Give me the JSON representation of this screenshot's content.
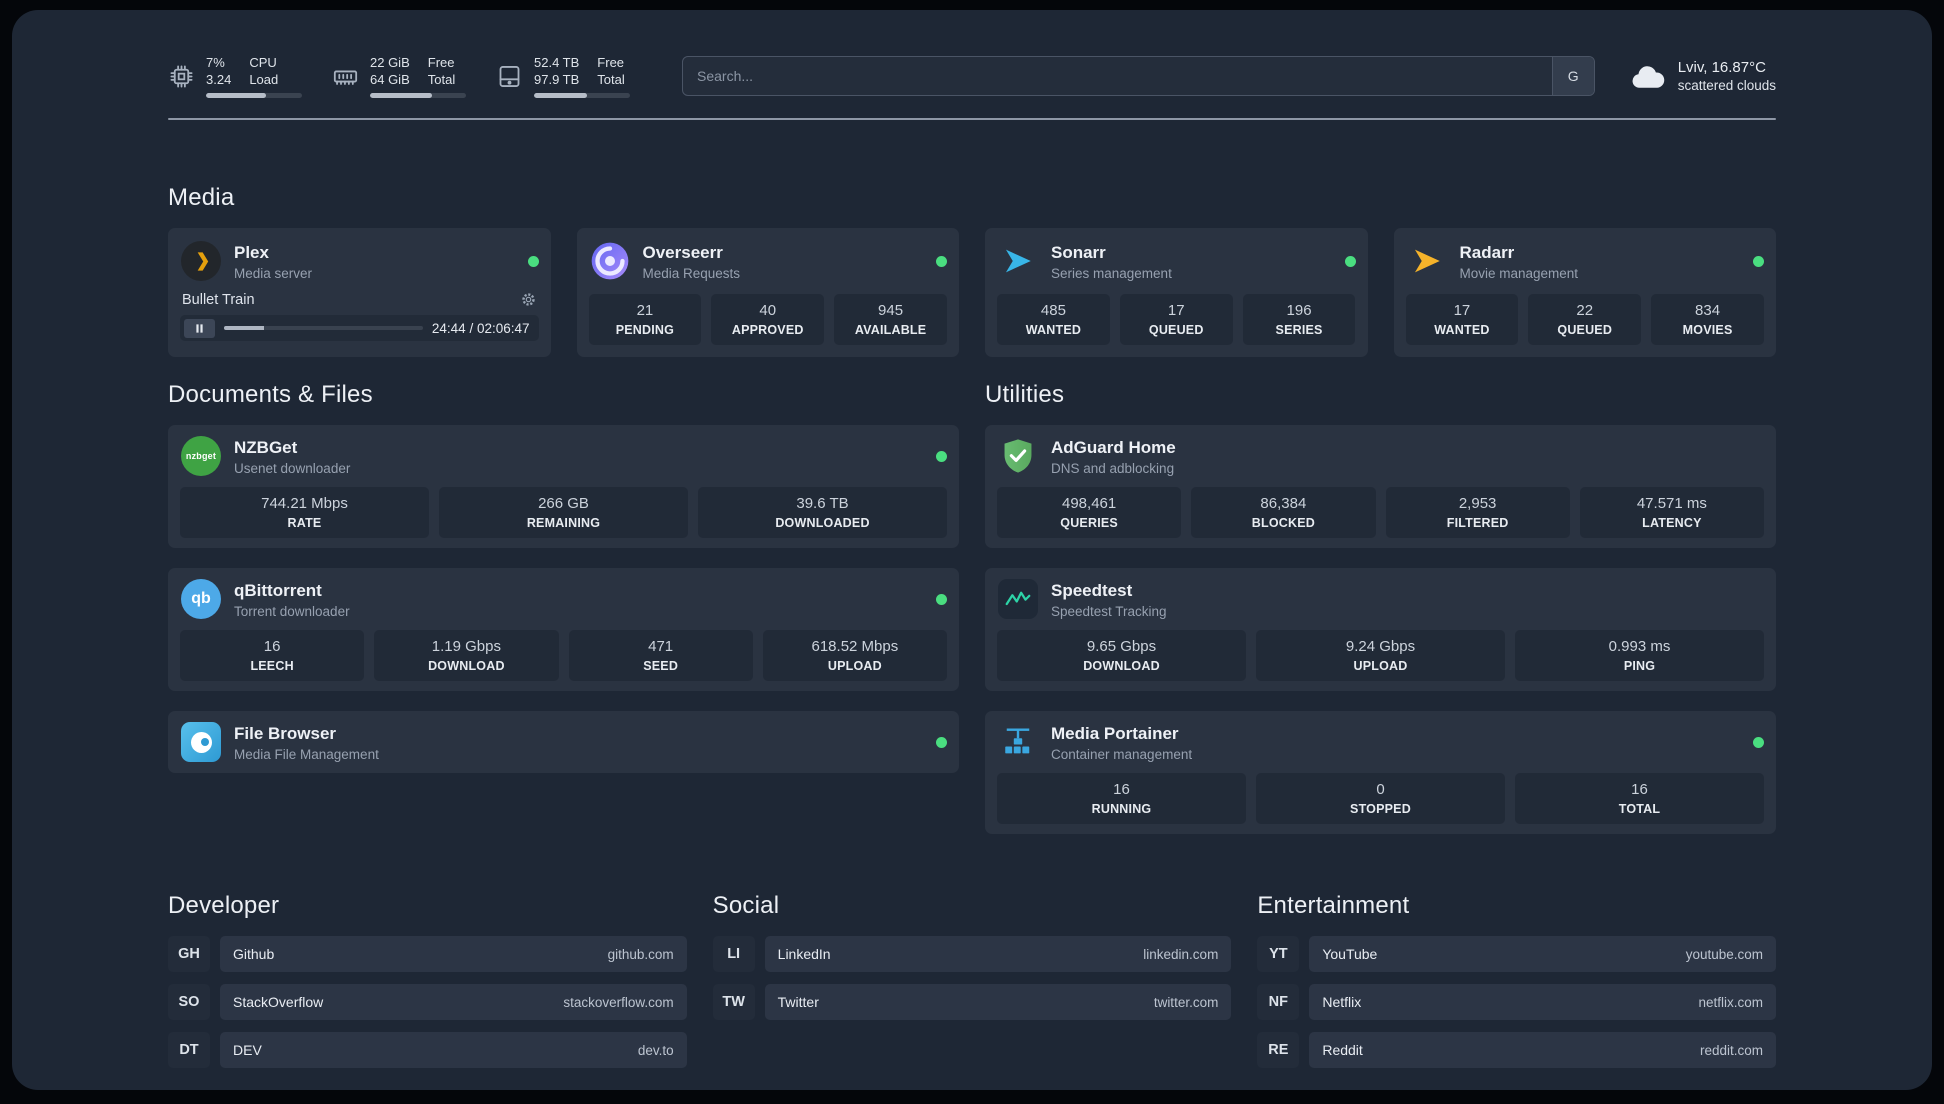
{
  "topbar": {
    "cpu": {
      "percent": "7%",
      "load": "3.24",
      "top_label": "CPU",
      "bottom_label": "Load",
      "progress": 62
    },
    "memory": {
      "free": "22 GiB",
      "total": "64 GiB",
      "top_label": "Free",
      "bottom_label": "Total",
      "progress": 65
    },
    "disk": {
      "free": "52.4 TB",
      "total": "97.9 TB",
      "top_label": "Free",
      "bottom_label": "Total",
      "progress": 55
    },
    "search": {
      "placeholder": "Search...",
      "button_label": "G"
    },
    "weather": {
      "location": "Lviv, 16.87°C",
      "condition": "scattered clouds"
    }
  },
  "media": {
    "title": "Media",
    "plex": {
      "name": "Plex",
      "desc": "Media server",
      "player": {
        "title": "Bullet Train",
        "time": "24:44 / 02:06:47",
        "progress": 20
      }
    },
    "overseerr": {
      "name": "Overseerr",
      "desc": "Media Requests",
      "stats": [
        {
          "value": "21",
          "label": "PENDING"
        },
        {
          "value": "40",
          "label": "APPROVED"
        },
        {
          "value": "945",
          "label": "AVAILABLE"
        }
      ]
    },
    "sonarr": {
      "name": "Sonarr",
      "desc": "Series management",
      "stats": [
        {
          "value": "485",
          "label": "WANTED"
        },
        {
          "value": "17",
          "label": "QUEUED"
        },
        {
          "value": "196",
          "label": "SERIES"
        }
      ]
    },
    "radarr": {
      "name": "Radarr",
      "desc": "Movie management",
      "stats": [
        {
          "value": "17",
          "label": "WANTED"
        },
        {
          "value": "22",
          "label": "QUEUED"
        },
        {
          "value": "834",
          "label": "MOVIES"
        }
      ]
    }
  },
  "documents": {
    "title": "Documents & Files",
    "nzbget": {
      "name": "NZBGet",
      "desc": "Usenet downloader",
      "stats": [
        {
          "value": "744.21 Mbps",
          "label": "RATE"
        },
        {
          "value": "266 GB",
          "label": "REMAINING"
        },
        {
          "value": "39.6 TB",
          "label": "DOWNLOADED"
        }
      ]
    },
    "qbittorrent": {
      "name": "qBittorrent",
      "desc": "Torrent downloader",
      "stats": [
        {
          "value": "16",
          "label": "LEECH"
        },
        {
          "value": "1.19 Gbps",
          "label": "DOWNLOAD"
        },
        {
          "value": "471",
          "label": "SEED"
        },
        {
          "value": "618.52 Mbps",
          "label": "UPLOAD"
        }
      ]
    },
    "filebrowser": {
      "name": "File Browser",
      "desc": "Media File Management"
    }
  },
  "utilities": {
    "title": "Utilities",
    "adguard": {
      "name": "AdGuard Home",
      "desc": "DNS and adblocking",
      "stats": [
        {
          "value": "498,461",
          "label": "QUERIES"
        },
        {
          "value": "86,384",
          "label": "BLOCKED"
        },
        {
          "value": "2,953",
          "label": "FILTERED"
        },
        {
          "value": "47.571 ms",
          "label": "LATENCY"
        }
      ]
    },
    "speedtest": {
      "name": "Speedtest",
      "desc": "Speedtest Tracking",
      "stats": [
        {
          "value": "9.65 Gbps",
          "label": "DOWNLOAD"
        },
        {
          "value": "9.24 Gbps",
          "label": "UPLOAD"
        },
        {
          "value": "0.993 ms",
          "label": "PING"
        }
      ]
    },
    "portainer": {
      "name": "Media Portainer",
      "desc": "Container management",
      "stats": [
        {
          "value": "16",
          "label": "RUNNING"
        },
        {
          "value": "0",
          "label": "STOPPED"
        },
        {
          "value": "16",
          "label": "TOTAL"
        }
      ]
    }
  },
  "bookmarks": {
    "developer": {
      "title": "Developer",
      "items": [
        {
          "abbr": "GH",
          "name": "Github",
          "url": "github.com"
        },
        {
          "abbr": "SO",
          "name": "StackOverflow",
          "url": "stackoverflow.com"
        },
        {
          "abbr": "DT",
          "name": "DEV",
          "url": "dev.to"
        }
      ]
    },
    "social": {
      "title": "Social",
      "items": [
        {
          "abbr": "LI",
          "name": "LinkedIn",
          "url": "linkedin.com"
        },
        {
          "abbr": "TW",
          "name": "Twitter",
          "url": "twitter.com"
        }
      ]
    },
    "entertainment": {
      "title": "Entertainment",
      "items": [
        {
          "abbr": "YT",
          "name": "YouTube",
          "url": "youtube.com"
        },
        {
          "abbr": "NF",
          "name": "Netflix",
          "url": "netflix.com"
        },
        {
          "abbr": "RE",
          "name": "Reddit",
          "url": "reddit.com"
        }
      ]
    }
  },
  "colors": {
    "status_online": "#4ade80",
    "plex_amber": "#e5a00d",
    "sonarr_blue": "#38b6e8",
    "radarr_yellow": "#f5b32a",
    "nzbget_green": "#3fa344",
    "qbittorrent_blue": "#4da9e8",
    "adguard_green": "#68bc71",
    "speedtest_green": "#2dd4a7",
    "portainer_blue": "#3aa7e0",
    "panel_bg": "#1e2735",
    "card_bg": "#2a3341"
  }
}
